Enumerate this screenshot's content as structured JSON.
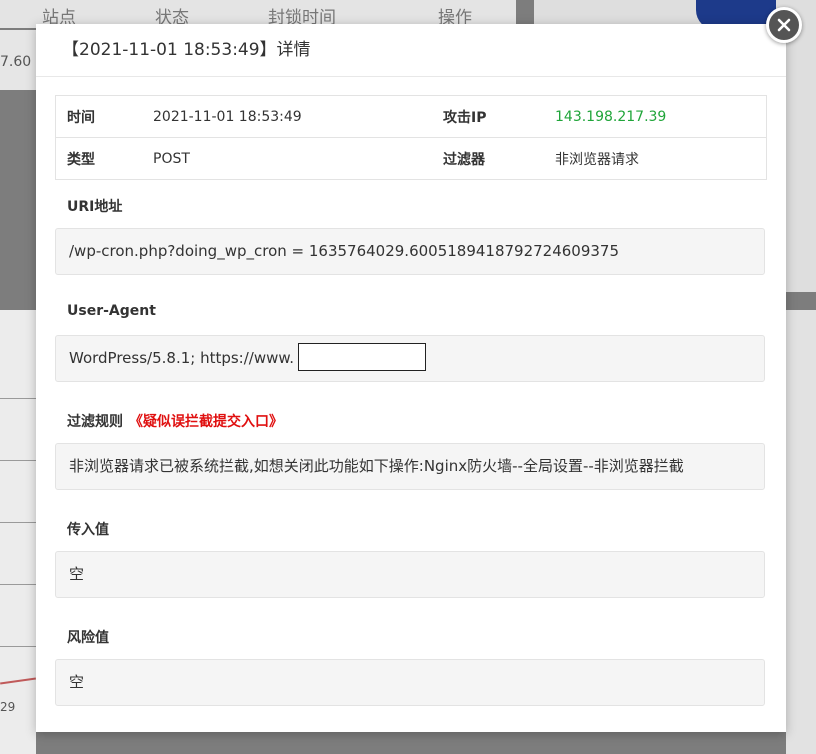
{
  "background": {
    "columns": [
      "站点",
      "状态",
      "封锁时间",
      "操作"
    ],
    "value_left": "7.60",
    "axis_tick": "29"
  },
  "modal": {
    "title": "【2021-11-01 18:53:49】详情",
    "info": {
      "time_label": "时间",
      "time_value": "2021-11-01 18:53:49",
      "ip_label": "攻击IP",
      "ip_value": "143.198.217.39",
      "type_label": "类型",
      "type_value": "POST",
      "filter_label": "过滤器",
      "filter_value": "非浏览器请求"
    },
    "uri": {
      "label": "URI地址",
      "value": "/wp-cron.php?doing_wp_cron = 1635764029.6005189418792724609375"
    },
    "user_agent": {
      "label": "User-Agent",
      "value": "WordPress/5.8.1; https://www."
    },
    "rule": {
      "label": "过滤规则",
      "link": "《疑似误拦截提交入口》",
      "value": "非浏览器请求已被系统拦截,如想关闭此功能如下操作:Nginx防火墙--全局设置--非浏览器拦截"
    },
    "input_value": {
      "label": "传入值",
      "value": "空"
    },
    "risk_value": {
      "label": "风险值",
      "value": "空"
    }
  },
  "colors": {
    "ip_green": "#20a53a",
    "link_red": "#e01010"
  }
}
